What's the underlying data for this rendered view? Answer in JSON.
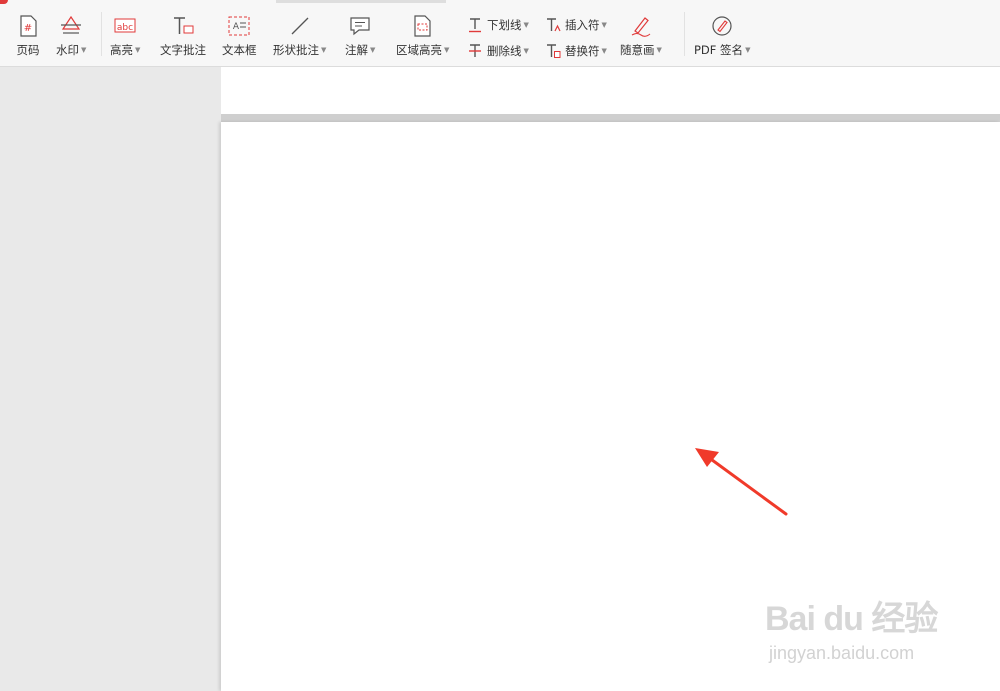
{
  "toolbar": {
    "page_number": "页码",
    "watermark": "水印",
    "highlight": "高亮",
    "text_annotation": "文字批注",
    "text_box": "文本框",
    "shape_annotation": "形状批注",
    "note": "注解",
    "area_highlight": "区域高亮",
    "underline": "下划线",
    "strikethrough": "删除线",
    "insert_mark": "插入符",
    "replace_mark": "替换符",
    "freehand": "随意画",
    "pdf_sign": "PDF 签名",
    "highlight_icon_text": "abc"
  },
  "watermark": {
    "logo": "Bai du 经验",
    "url": "jingyan.baidu.com"
  },
  "colors": {
    "accent_red": "#e03a3a",
    "arrow_red": "#f03a2a"
  }
}
